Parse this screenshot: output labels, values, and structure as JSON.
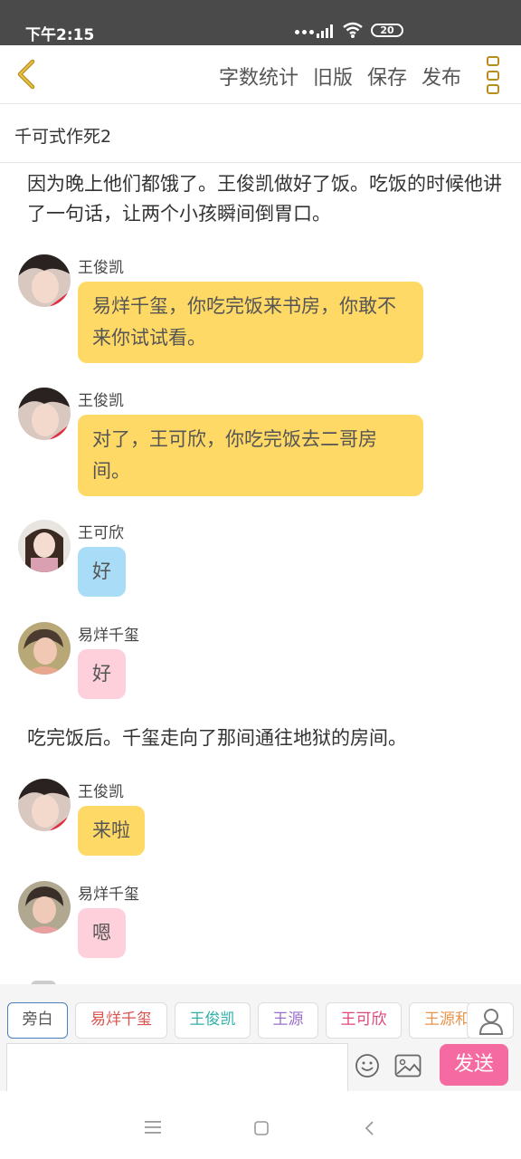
{
  "status": {
    "time": "下午2:15",
    "battery": "20"
  },
  "appbar": {
    "actions": [
      "字数统计",
      "旧版",
      "保存",
      "发布"
    ]
  },
  "title": "千可式作死2",
  "content": {
    "narration1": "因为晚上他们都饿了。王俊凯做好了饭。吃饭的时候他讲了一句话，让两个小孩瞬间倒胃口。",
    "messages": [
      {
        "name": "王俊凯",
        "text": "易烊千玺，你吃完饭来书房，你敢不来你试试看。"
      },
      {
        "name": "王俊凯",
        "text": "对了，王可欣，你吃完饭去二哥房间。"
      },
      {
        "name": "王可欣",
        "text": "好"
      },
      {
        "name": "易烊千玺",
        "text": "好"
      },
      {
        "name": "王俊凯",
        "text": "来啦"
      },
      {
        "name": "易烊千玺",
        "text": "嗯"
      }
    ],
    "narration2": "吃完饭后。千玺走向了那间通往地狱的房间。"
  },
  "chips": [
    {
      "label": "旁白",
      "color": "#555555"
    },
    {
      "label": "易烊千玺",
      "color": "#d9534f"
    },
    {
      "label": "王俊凯",
      "color": "#2fb0a8"
    },
    {
      "label": "王源",
      "color": "#9b6fc9"
    },
    {
      "label": "王可欣",
      "color": "#e0457b"
    },
    {
      "label": "王源和",
      "color": "#e8964f"
    }
  ],
  "input": {
    "send_label": "发送"
  },
  "colors": {
    "bubble_yellow": "#ffd966",
    "bubble_blue": "#a8dcf7",
    "bubble_pink": "#fdd0dc",
    "send": "#f56aa0",
    "accent": "#b88e1a"
  }
}
